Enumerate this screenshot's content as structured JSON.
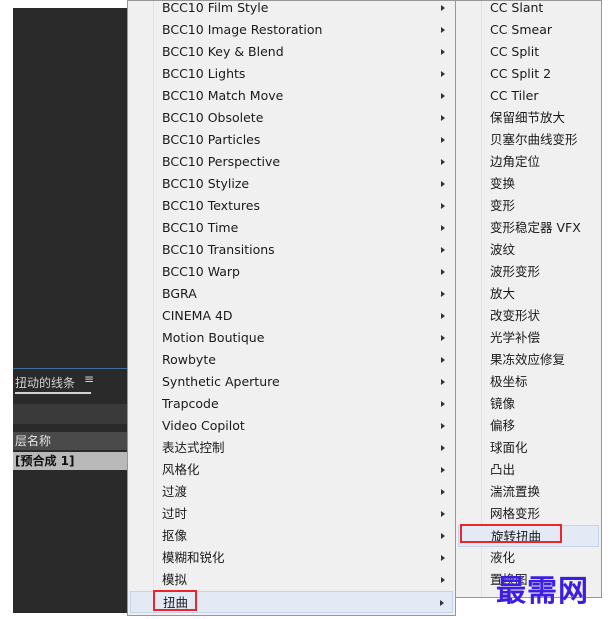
{
  "background_panel": {
    "tab_label": "扭动的线条",
    "tab_menu_icon": "hamburger-icon",
    "column_header": "层名称",
    "layer_row": "[预合成 1]"
  },
  "left_menu": {
    "items": [
      {
        "label": "BCC10 Film Style",
        "submenu": true
      },
      {
        "label": "BCC10 Image Restoration",
        "submenu": true
      },
      {
        "label": "BCC10 Key & Blend",
        "submenu": true
      },
      {
        "label": "BCC10 Lights",
        "submenu": true
      },
      {
        "label": "BCC10 Match Move",
        "submenu": true
      },
      {
        "label": "BCC10 Obsolete",
        "submenu": true
      },
      {
        "label": "BCC10 Particles",
        "submenu": true
      },
      {
        "label": "BCC10 Perspective",
        "submenu": true
      },
      {
        "label": "BCC10 Stylize",
        "submenu": true
      },
      {
        "label": "BCC10 Textures",
        "submenu": true
      },
      {
        "label": "BCC10 Time",
        "submenu": true
      },
      {
        "label": "BCC10 Transitions",
        "submenu": true
      },
      {
        "label": "BCC10 Warp",
        "submenu": true
      },
      {
        "label": "BGRA",
        "submenu": true
      },
      {
        "label": "CINEMA 4D",
        "submenu": true
      },
      {
        "label": "Motion Boutique",
        "submenu": true
      },
      {
        "label": "Rowbyte",
        "submenu": true
      },
      {
        "label": "Synthetic Aperture",
        "submenu": true
      },
      {
        "label": "Trapcode",
        "submenu": true
      },
      {
        "label": "Video Copilot",
        "submenu": true
      },
      {
        "label": "表达式控制",
        "submenu": true
      },
      {
        "label": "风格化",
        "submenu": true
      },
      {
        "label": "过渡",
        "submenu": true
      },
      {
        "label": "过时",
        "submenu": true
      },
      {
        "label": "抠像",
        "submenu": true
      },
      {
        "label": "模糊和锐化",
        "submenu": true
      },
      {
        "label": "模拟",
        "submenu": true
      },
      {
        "label": "扭曲",
        "submenu": true,
        "highlighted": true
      }
    ]
  },
  "right_menu": {
    "items": [
      {
        "label": "CC Slant"
      },
      {
        "label": "CC Smear"
      },
      {
        "label": "CC Split"
      },
      {
        "label": "CC Split 2"
      },
      {
        "label": "CC Tiler"
      },
      {
        "label": "保留细节放大"
      },
      {
        "label": "贝塞尔曲线变形"
      },
      {
        "label": "边角定位"
      },
      {
        "label": "变换"
      },
      {
        "label": "变形"
      },
      {
        "label": "变形稳定器 VFX"
      },
      {
        "label": "波纹"
      },
      {
        "label": "波形变形"
      },
      {
        "label": "放大"
      },
      {
        "label": "改变形状"
      },
      {
        "label": "光学补偿"
      },
      {
        "label": "果冻效应修复"
      },
      {
        "label": "极坐标"
      },
      {
        "label": "镜像"
      },
      {
        "label": "偏移"
      },
      {
        "label": "球面化"
      },
      {
        "label": "凸出"
      },
      {
        "label": "湍流置换"
      },
      {
        "label": "网格变形"
      },
      {
        "label": "旋转扭曲",
        "highlighted": true
      },
      {
        "label": "液化"
      },
      {
        "label": "置换图"
      }
    ]
  },
  "watermark": "最需网",
  "colors": {
    "menu_bg": "#f0f0f0",
    "highlight": "#e3eaf5",
    "annotation_red": "#e8262c",
    "watermark": "#3c1ee0"
  }
}
